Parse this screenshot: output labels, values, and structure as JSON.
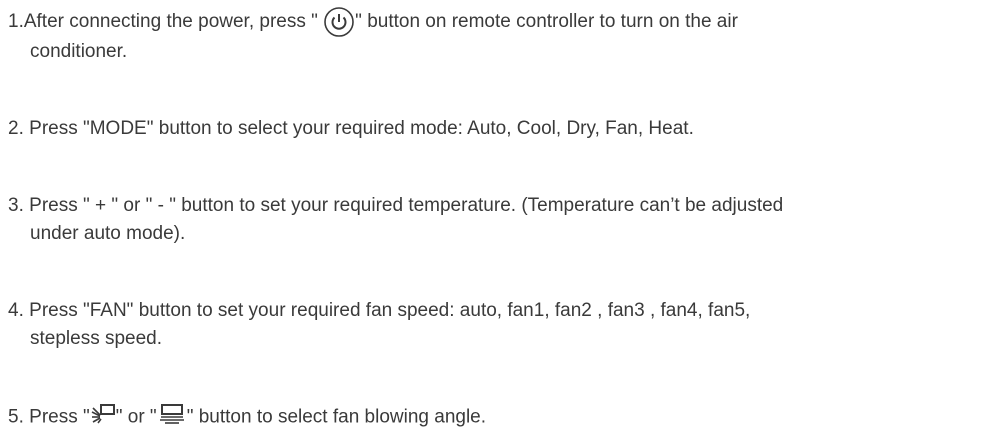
{
  "steps": [
    {
      "number": "1.",
      "parts": [
        "After connecting the power, press \"",
        "\" button on remote controller to turn on the air",
        "conditioner."
      ],
      "icon": "power-icon"
    },
    {
      "number": "2.",
      "text": "Press \"MODE\" button to select your required mode: Auto, Cool, Dry, Fan, Heat."
    },
    {
      "number": "3.",
      "lines": [
        "Press \" + \" or \" - \" button to set your required temperature. (Temperature can’t  be adjusted",
        "under auto mode)."
      ]
    },
    {
      "number": "4.",
      "lines": [
        "Press \"FAN\" button to set your required fan speed: auto,  fan1, fan2 , fan3 ,  fan4, fan5,",
        "stepless speed."
      ]
    },
    {
      "number": "5.",
      "parts": [
        "Press \"",
        "\" or \"",
        "\" button to select fan blowing angle."
      ],
      "icons": [
        "swing-angle-icon",
        "fixed-angle-icon"
      ]
    }
  ]
}
